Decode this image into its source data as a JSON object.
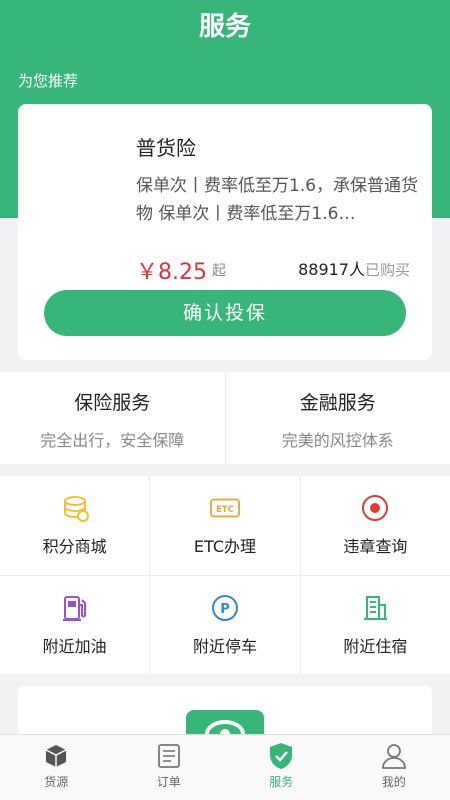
{
  "header": {
    "title": "服务"
  },
  "recommend": {
    "section_label": "为您推荐",
    "name": "普货险",
    "description": "保单次丨费率低至万1.6，承保普通货物 保单次丨费率低至万1.6…",
    "price": "￥8.25",
    "price_suffix": "起",
    "sales_count": "88917人",
    "sales_unit": "已购买",
    "confirm_label": "确认投保"
  },
  "services": [
    {
      "title": "保险服务",
      "subtitle": "完全出行，安全保障"
    },
    {
      "title": "金融服务",
      "subtitle": "完美的风控体系"
    }
  ],
  "grid": [
    {
      "icon": "coins-icon",
      "label": "积分商城"
    },
    {
      "icon": "etc-icon",
      "label": "ETC办理"
    },
    {
      "icon": "violation-icon",
      "label": "违章查询"
    },
    {
      "icon": "gas-station-icon",
      "label": "附近加油"
    },
    {
      "icon": "parking-icon",
      "label": "附近停车"
    },
    {
      "icon": "hotel-icon",
      "label": "附近住宿"
    }
  ],
  "tabbar": [
    {
      "icon": "box-icon",
      "label": "货源",
      "active": false
    },
    {
      "icon": "order-icon",
      "label": "订单",
      "active": false
    },
    {
      "icon": "shield-check-icon",
      "label": "服务",
      "active": true
    },
    {
      "icon": "user-icon",
      "label": "我的",
      "active": false
    }
  ],
  "colors": {
    "brand_green": "#36b779",
    "price_red": "#d9363e",
    "coins_yellow": "#f2c12e",
    "etc_orange": "#f0a23b",
    "violation_red": "#e23b3b",
    "gas_purple": "#9c4fd0",
    "parking_blue": "#2e86de",
    "hotel_green": "#36b779"
  }
}
